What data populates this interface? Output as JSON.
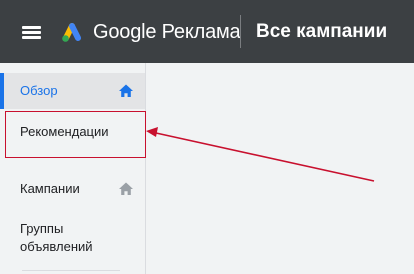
{
  "header": {
    "product_name": "Google Реклама",
    "page_title": "Все кампании",
    "menu_icon": "hamburger-menu-icon",
    "logo_icon": "google-ads-logo-icon",
    "background_color": "#3c4043"
  },
  "sidebar": {
    "items": [
      {
        "label": "Обзор",
        "icon": "home-icon",
        "active": true
      },
      {
        "label": "Рекомендации",
        "highlighted": true
      },
      {
        "label": "Кампании",
        "icon": "home-icon"
      },
      {
        "label": "Группы объявлений"
      }
    ],
    "accent_color": "#1a73e8"
  },
  "annotation": {
    "color": "#c8102e",
    "arrow_icon": "red-pointer-arrow"
  }
}
